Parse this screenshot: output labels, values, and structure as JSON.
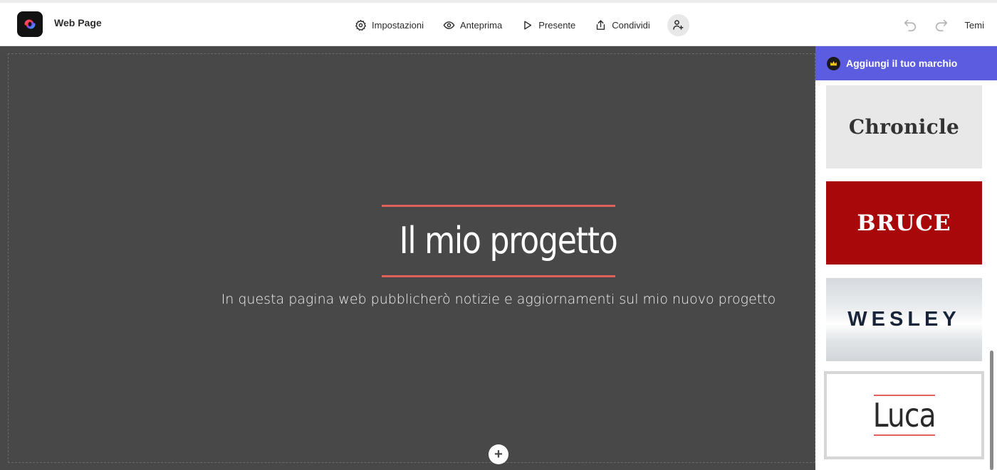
{
  "app": {
    "title": "Web Page"
  },
  "toolbar": {
    "settings_label": "Impostazioni",
    "preview_label": "Anteprima",
    "present_label": "Presente",
    "share_label": "Condividi",
    "themes_label": "Temi"
  },
  "icons": {
    "settings": "gear-icon",
    "preview": "eye-icon",
    "present": "play-icon",
    "share": "share-icon",
    "invite": "add-person-icon",
    "undo": "undo-icon",
    "redo": "redo-icon",
    "add_block": "plus-icon",
    "brand": "crown-icon"
  },
  "canvas": {
    "title": "Il mio progetto",
    "subtitle": "In questa pagina web pubblicherò notizie e aggiornamenti sul mio nuovo progetto",
    "add_block_label": "+"
  },
  "panel": {
    "brand_banner": "Aggiungi il tuo marchio",
    "themes": [
      {
        "name": "Chronicle"
      },
      {
        "name": "BRUCE"
      },
      {
        "name": "WESLEY"
      },
      {
        "name": "Luca"
      }
    ]
  },
  "colors": {
    "accent_line": "#e0605a",
    "brand_banner": "#5c5ce0",
    "canvas_bg": "#484848",
    "bruce_bg": "#a8080a"
  }
}
